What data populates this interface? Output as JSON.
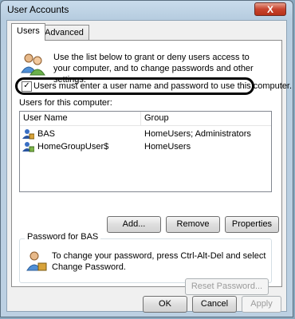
{
  "window": {
    "title": "User Accounts",
    "close_symbol": "X"
  },
  "tabs": [
    {
      "label": "Users",
      "active": true
    },
    {
      "label": "Advanced",
      "active": false
    }
  ],
  "intro_text": "Use the list below to grant or deny users access to your computer, and to change passwords and other settings.",
  "require_login_checkbox": {
    "label": "Users must enter a user name and password to use this computer.",
    "checked": true
  },
  "users_section_label": "Users for this computer:",
  "users_table": {
    "columns": [
      "User Name",
      "Group"
    ],
    "rows": [
      {
        "name": "BAS",
        "group": "HomeUsers; Administrators"
      },
      {
        "name": "HomeGroupUser$",
        "group": "HomeUsers"
      }
    ]
  },
  "buttons": {
    "add": "Add...",
    "remove": "Remove",
    "properties": "Properties"
  },
  "password_group": {
    "title": "Password for BAS",
    "text": "To change your password, press Ctrl-Alt-Del and select Change Password.",
    "reset_button": "Reset Password..."
  },
  "footer_buttons": {
    "ok": "OK",
    "cancel": "Cancel",
    "apply": "Apply"
  }
}
